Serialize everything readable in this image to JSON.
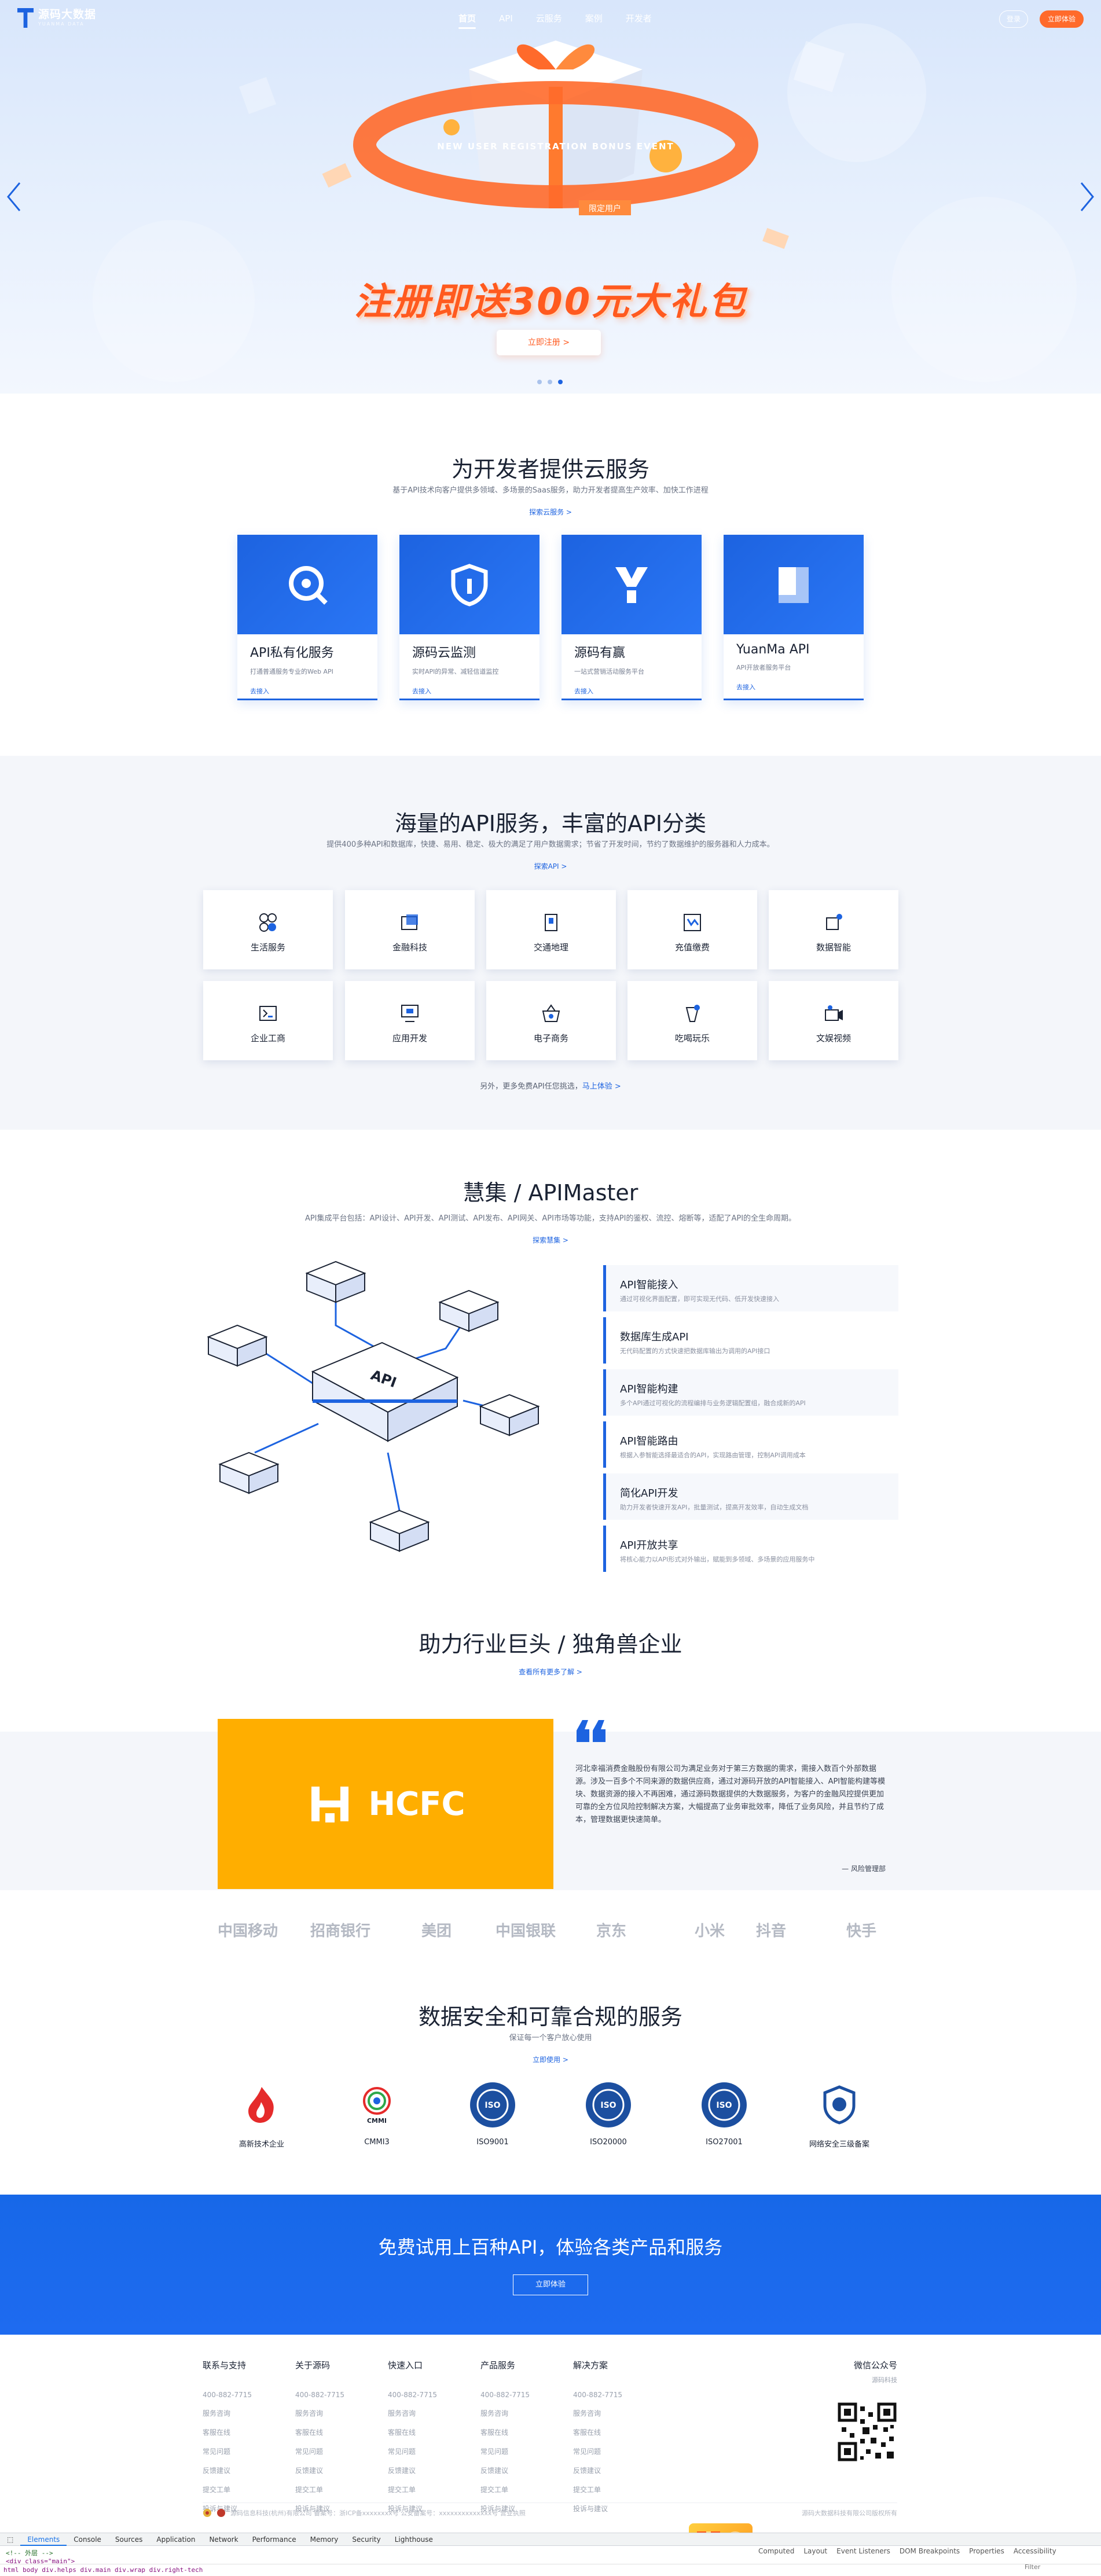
{
  "header": {
    "logo_text": "源码大数据",
    "logo_sub": "YUANMA DATA",
    "nav": [
      "首页",
      "API",
      "云服务",
      "案例",
      "开发者"
    ],
    "login": "登录",
    "register": "立即体验"
  },
  "banner": {
    "ribbon_text": "NEW USER REGISTRATION BONUS EVENT",
    "tag": "限定用户",
    "title": "注册即送300元大礼包",
    "button": "立即注册 >",
    "prev_icon": "chevron-left-icon",
    "next_icon": "chevron-right-icon"
  },
  "cloud": {
    "title": "为开发者提供云服务",
    "subtitle": "基于API技术向客户提供多领域、多场景的Saas服务，助力开发者提高生产效率、加快工作进程",
    "link": "探索云服务 >",
    "cards": [
      {
        "title": "API私有化服务",
        "desc": "打通普通服务专业的Web API",
        "link": "去接入"
      },
      {
        "title": "源码云监测",
        "desc": "实时API的异常、减轻信道监控",
        "link": "去接入"
      },
      {
        "title": "源码有赢",
        "desc": "一站式营销活动服务平台",
        "link": "去接入"
      },
      {
        "title": "YuanMa API",
        "desc": "API开放者服务平台",
        "link": "去接入"
      }
    ]
  },
  "categories": {
    "title": "海量的API服务，丰富的API分类",
    "subtitle": "提供400多种API和数据库，快捷、易用、稳定、极大的满足了用户数据需求；节省了开发时间，节约了数据维护的服务器和人力成本。",
    "link": "探索API >",
    "items": [
      "生活服务",
      "金融科技",
      "交通地理",
      "充值缴费",
      "数据智能",
      "企业工商",
      "应用开发",
      "电子商务",
      "吃喝玩乐",
      "文娱视频"
    ],
    "footer_text": "另外，更多免费API任您挑选，",
    "footer_link": "马上体验 >"
  },
  "apimaster": {
    "title": "慧集 / APIMaster",
    "subtitle": "API集成平台包括：API设计、API开发、API测试、API发布、API网关、API市场等功能，支持API的鉴权、流控、熔断等，适配了API的全生命周期。",
    "link": "探索慧集 >",
    "features": [
      {
        "title": "API智能接入",
        "desc": "通过可视化界面配置，即可实现无代码、低开发快速接入"
      },
      {
        "title": "数据库生成API",
        "desc": "无代码配置的方式快速把数据库输出为调用的API接口"
      },
      {
        "title": "API智能构建",
        "desc": "多个API通过可视化的流程编排与业务逻辑配置组，融合成新的API"
      },
      {
        "title": "API智能路由",
        "desc": "根据入参智能选择最适合的API，实现路由管理，控制API调用成本"
      },
      {
        "title": "简化API开发",
        "desc": "助力开发者快速开发API，批量测试，提高开发效率，自动生成文档"
      },
      {
        "title": "API开放共享",
        "desc": "将核心能力以API形式对外输出，赋能到多领域、多场景的应用服务中"
      }
    ]
  },
  "industry": {
    "title": "助力行业巨头 / 独角兽企业",
    "link": "查看所有更多了解 >",
    "client_logo": "HCFC",
    "quote": "河北幸福消费金融股份有限公司为满足业务对于第三方数据的需求，需接入数百个外部数据源。涉及一百多个不同来源的数据供应商，通过对源码开放的API智能接入、API智能构建等模块、数据资源的接入不再困难，通过源码数据提供的大数据服务，为客户的金融风控提供更加可靠的全方位风险控制解决方案，大幅提高了业务审批效率，降低了业务风险，并且节约了成本，管理数据更快速简单。",
    "attribution": "风险管理部"
  },
  "partners": [
    "中国移动",
    "招商银行",
    "美团",
    "中国银联",
    "京东",
    "小米",
    "抖音",
    "快手"
  ],
  "compliance": {
    "title": "数据安全和可靠合规的服务",
    "subtitle": "保证每一个客户放心使用",
    "link": "立即使用 >",
    "certs": [
      "高新技术企业",
      "CMMI3",
      "ISO9001",
      "ISO20000",
      "ISO27001",
      "网络安全三级备案"
    ]
  },
  "cta": {
    "title": "免费试用上百种API，体验各类产品和服务",
    "button": "立即体验"
  },
  "footer": {
    "columns": [
      {
        "heading": "联系与支持",
        "items": [
          "400-882-7715",
          "服务咨询",
          "客服在线",
          "常见问题",
          "反馈建议",
          "提交工单",
          "投诉与建议"
        ]
      },
      {
        "heading": "关于源码",
        "items": [
          "400-882-7715",
          "服务咨询",
          "客服在线",
          "常见问题",
          "反馈建议",
          "提交工单",
          "投诉与建议"
        ]
      },
      {
        "heading": "快速入口",
        "items": [
          "400-882-7715",
          "服务咨询",
          "客服在线",
          "常见问题",
          "反馈建议",
          "提交工单",
          "投诉与建议"
        ]
      },
      {
        "heading": "产品服务",
        "items": [
          "400-882-7715",
          "服务咨询",
          "客服在线",
          "常见问题",
          "反馈建议",
          "提交工单",
          "投诉与建议"
        ]
      },
      {
        "heading": "解决方案",
        "items": [
          "400-882-7715",
          "服务咨询",
          "客服在线",
          "常见问题",
          "反馈建议",
          "提交工单",
          "投诉与建议"
        ]
      }
    ],
    "wechat_title": "微信公众号",
    "wechat_sub": "源码科技",
    "legal": "源码信息科技(杭州)有限公司   备案号：浙ICP备xxxxxxxx号   公安备案号：xxxxxxxxxxxxxx号   营业执照",
    "right_text": "源码大数据科技有限公司版权所有"
  },
  "devtools": {
    "tabs": [
      "Elements",
      "Console",
      "Sources",
      "Application",
      "Network",
      "Performance",
      "Memory",
      "Security",
      "Lighthouse"
    ],
    "right_tabs": [
      "Computed",
      "Layout",
      "Event Listeners",
      "DOM Breakpoints",
      "Properties",
      "Accessibility"
    ],
    "code_line1": "<!-- 外层 -->",
    "code_line2": "<div class=\"main\">",
    "breadcrumb": "html   body   div.helps   div.main   div.wrap   div.right-tech",
    "filter_placeholder": "Filter"
  }
}
